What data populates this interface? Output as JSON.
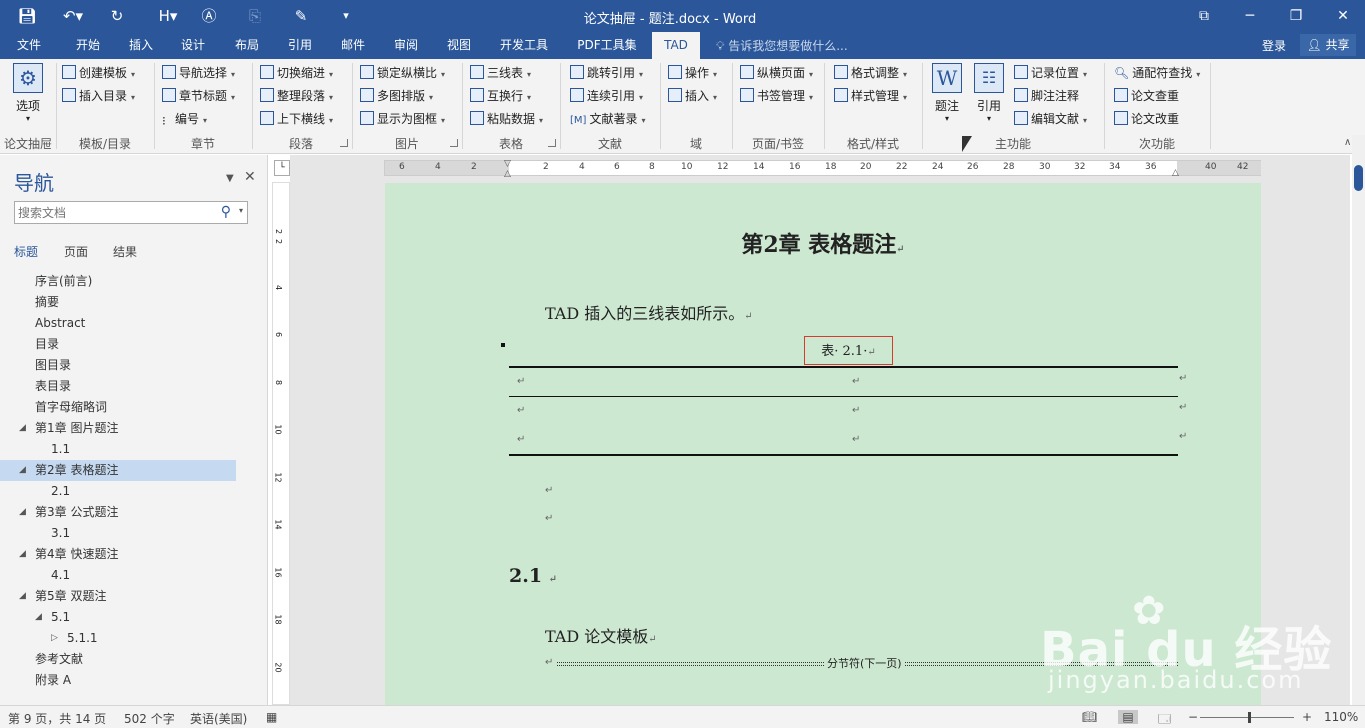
{
  "window": {
    "title": "论文抽屉 - 题注.docx - Word",
    "qat": [
      "save-icon",
      "undo-icon",
      "redo-icon",
      "heading-icon",
      "textbox-icon",
      "stamp-icon",
      "brush-icon",
      "more-icon"
    ],
    "controls": {
      "restore_ribbon": "⧉",
      "minimize": "─",
      "maximize": "❐",
      "close": "✕"
    }
  },
  "tabs": [
    "文件",
    "开始",
    "插入",
    "设计",
    "布局",
    "引用",
    "邮件",
    "审阅",
    "视图",
    "开发工具",
    "PDF工具集",
    "TAD"
  ],
  "active_tab": "TAD",
  "tell_me": "告诉我您想要做什么...",
  "login": "登录",
  "share": "共享",
  "ribbon": {
    "big_options": "选项",
    "items": {
      "create_template": "创建模板",
      "insert_toc": "插入目录",
      "nav_select": "导航选择",
      "chapter_heading": "章节标题",
      "numbering": "编号",
      "switch_indent": "切换缩进",
      "tidy_paragraph": "整理段落",
      "top_bottom_line": "上下横线",
      "lock_ratio": "锁定纵横比",
      "multi_layout": "多图排版",
      "show_frame": "显示为图框",
      "three_line": "三线表",
      "swap_row": "互换行",
      "paste_data": "粘贴数据",
      "jump_ref": "跳转引用",
      "cont_ref": "连续引用",
      "ref_mark": "文献著录",
      "operate": "操作",
      "insert_field": "插入",
      "portrait_page": "纵横页面",
      "bookmark_mgmt": "书签管理",
      "format_adjust": "格式调整",
      "style_mgmt": "样式管理",
      "caption": "题注",
      "cite": "引用",
      "record_pos": "记录位置",
      "footnote": "脚注注释",
      "edit_refs": "编辑文献",
      "wildcard_find": "通配符查找",
      "paper_check": "论文查重",
      "paper_revise": "论文改重"
    },
    "ref_mark_prefix": "[M]",
    "groups": [
      "论文抽屉",
      "模板/目录",
      "章节",
      "段落",
      "图片",
      "表格",
      "文献",
      "域",
      "页面/书签",
      "格式/样式",
      "主功能",
      "次功能"
    ]
  },
  "nav": {
    "title": "导航",
    "search_placeholder": "搜索文档",
    "tabs": [
      "标题",
      "页面",
      "结果"
    ],
    "items": [
      "序言(前言)",
      "摘要",
      "Abstract",
      "目录",
      "图目录",
      "表目录",
      "首字母缩略词",
      "第1章 图片题注",
      "1.1",
      "第2章 表格题注",
      "2.1",
      "第3章 公式题注",
      "3.1",
      "第4章 快速题注",
      "4.1",
      "第5章 双题注",
      "5.1",
      "5.1.1",
      "参考文献",
      "附录 A"
    ]
  },
  "ruler": [
    "6",
    "4",
    "2",
    "2",
    "4",
    "6",
    "8",
    "10",
    "12",
    "14",
    "16",
    "18",
    "20",
    "22",
    "24",
    "26",
    "28",
    "30",
    "32",
    "34",
    "36",
    "40",
    "42"
  ],
  "vruler": [
    "2",
    "2",
    "4",
    "6",
    "8",
    "10",
    "12",
    "14",
    "16",
    "18",
    "20"
  ],
  "document": {
    "chapter_heading": "第2章 表格题注",
    "para1": "TAD 插入的三线表如所示。",
    "caption": "表· 2.1·",
    "heading21": "2.1",
    "para2": "TAD 论文模板",
    "section_break": "分节符(下一页)",
    "return_mark": "↵"
  },
  "status": {
    "page": "第 9 页，共 14 页",
    "words": "502 个字",
    "lang": "英语(美国)",
    "zoom": "110%",
    "zoom_minus": "−",
    "zoom_plus": "+"
  },
  "watermark": {
    "main": "Bai du 经验",
    "sub": "jingyan.baidu.com",
    "paw": "✿"
  }
}
